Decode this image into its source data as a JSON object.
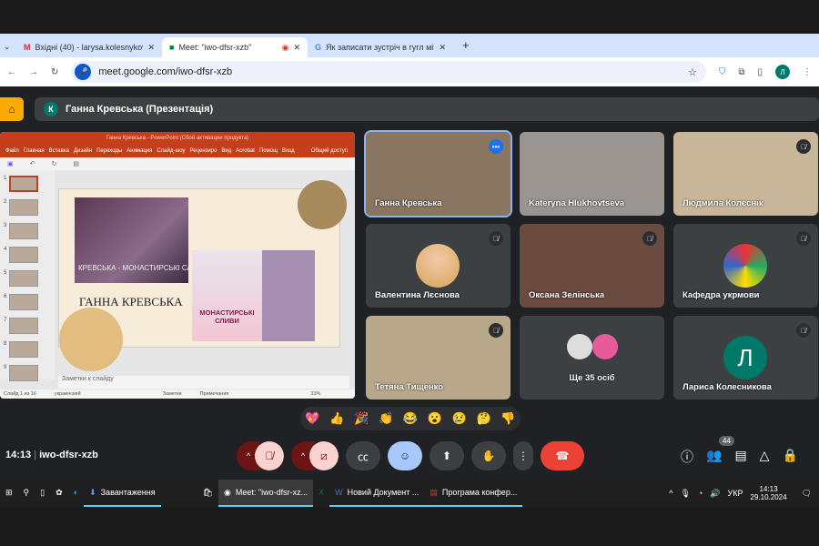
{
  "browser": {
    "tabs": [
      {
        "title": "Вхідні (40) - larysa.kolesnykova",
        "icon": "gmail-icon"
      },
      {
        "title": "Meet: \"iwo-dfsr-xzb\"",
        "icon": "meet-icon",
        "active": true
      },
      {
        "title": "Як записати зустріч в гугл міт",
        "icon": "google-icon"
      }
    ],
    "new_tab": "+",
    "url": "meet.google.com/iwo-dfsr-xzb",
    "profile": "Л"
  },
  "meet": {
    "presenter_initial": "К",
    "presenter_label": "Ганна Кревська (Презентація)",
    "presentation": {
      "title": "Ганна Кревська - PowerPoint (Сбой активации продукта)",
      "menu": [
        "Файл",
        "Главная",
        "Вставка",
        "Дизайн",
        "Переходы",
        "Анимация",
        "Слайд-шоу",
        "Рецензиро",
        "Вид",
        "Acrobat",
        "Помощ",
        "Вход",
        "Общий доступ"
      ],
      "slide_heading": "ГАННА КРЕВСЬКА",
      "book_title": "МОНАСТИРСЬКІ СЛИВИ",
      "banner": "КРЕВСЬКА - МОНАСТИРСЬКІ СЛИВИ",
      "thumb_numbers": [
        "1",
        "2",
        "3",
        "4",
        "5",
        "6",
        "7",
        "8",
        "9"
      ],
      "notes_placeholder": "Заметки к слайду",
      "status": {
        "slide": "Слайд 1 из 16",
        "lang": "украинский",
        "notes": "Заметки",
        "comments": "Примечания",
        "zoom": "33%"
      }
    },
    "participants": [
      {
        "name": "Ганна Кревська",
        "video": true,
        "active": true
      },
      {
        "name": "Kateryna Hlukhovtseva",
        "video": true
      },
      {
        "name": "Людмила Колєснік",
        "video": true,
        "muted": true
      },
      {
        "name": "Валентина Лєснова",
        "muted": true
      },
      {
        "name": "Оксана Зелінська",
        "video": true,
        "muted": true
      },
      {
        "name": "Кафедра укрмови",
        "muted": true
      },
      {
        "name": "Тетяна Тищенко",
        "video": true,
        "muted": true
      },
      {
        "name": "Ще 35 осіб"
      },
      {
        "name": "Лариса Колесникова",
        "initial": "Л",
        "muted": true
      }
    ],
    "reactions": [
      "💖",
      "👍",
      "🎉",
      "👏",
      "😂",
      "😮",
      "😢",
      "🤔",
      "👎"
    ],
    "time": "14:13",
    "meeting_code": "iwo-dfsr-xzb",
    "participant_count": "44",
    "colors": {
      "end_call": "#ea4335",
      "accent": "#8ab4f8",
      "muted_bg": "#6d1414"
    }
  },
  "taskbar": {
    "items": [
      "Завантаження",
      "Meet: \"iwo-dfsr-xz...",
      "Новий Документ ...",
      "Програма конфер..."
    ],
    "lang": "УКР",
    "time": "14:13",
    "date": "29.10.2024"
  }
}
